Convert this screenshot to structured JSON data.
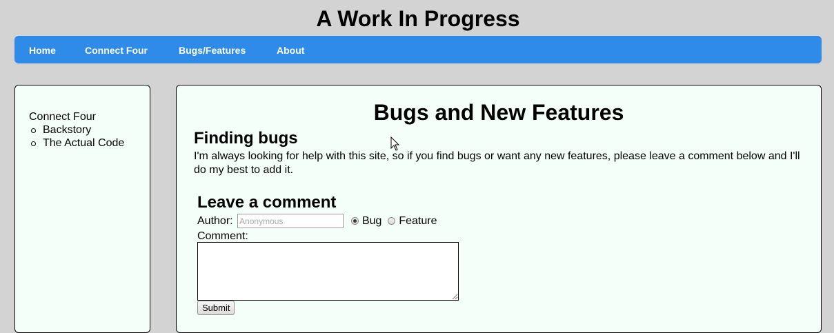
{
  "site": {
    "title": "A Work In Progress"
  },
  "nav": {
    "items": [
      {
        "label": "Home"
      },
      {
        "label": "Connect Four"
      },
      {
        "label": "Bugs/Features"
      },
      {
        "label": "About"
      }
    ],
    "color": "#2f8be8"
  },
  "sidebar": {
    "heading": "Connect Four",
    "items": [
      {
        "label": "Backstory"
      },
      {
        "label": "The Actual Code"
      }
    ]
  },
  "main": {
    "title": "Bugs and New Features",
    "section": {
      "title": "Finding bugs",
      "body": "I'm always looking for help with this site, so if you find bugs or want any new features, please leave a comment below and I'll do my best to add it."
    },
    "form": {
      "title": "Leave a comment",
      "author_label": "Author:",
      "author_placeholder": "Anonymous",
      "author_value": "",
      "type_options": [
        {
          "label": "Bug",
          "selected": true
        },
        {
          "label": "Feature",
          "selected": false
        }
      ],
      "comment_label": "Comment:",
      "comment_value": "",
      "submit_label": "Submit"
    }
  },
  "colors": {
    "background": "#d3d3d3",
    "panel": "#f3fff8",
    "nav_text": "#ffffff"
  },
  "icons": {
    "cursor": "mouse-pointer-icon",
    "radio": "radio-icon"
  }
}
